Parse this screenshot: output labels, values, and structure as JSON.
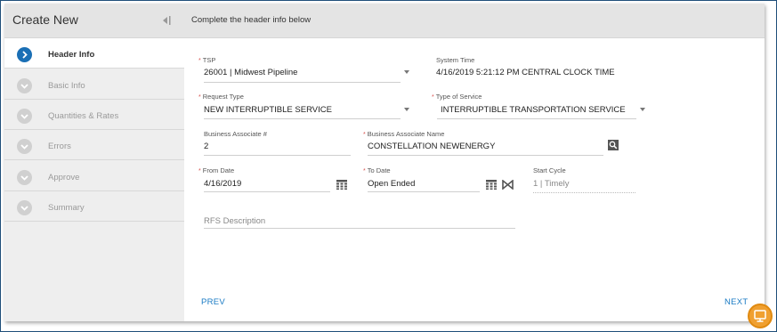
{
  "header": {
    "title": "Create New",
    "subtitle": "Complete the header info below",
    "collapse_icon": "collapse-left-icon"
  },
  "sidebar": {
    "steps": [
      {
        "label": "Header Info",
        "active": true
      },
      {
        "label": "Basic Info",
        "active": false
      },
      {
        "label": "Quantities & Rates",
        "active": false
      },
      {
        "label": "Errors",
        "active": false
      },
      {
        "label": "Approve",
        "active": false
      },
      {
        "label": "Summary",
        "active": false
      }
    ]
  },
  "form": {
    "tsp": {
      "label": "TSP",
      "required": "*",
      "value": "26001 | Midwest Pipeline"
    },
    "system_time": {
      "label": "System Time",
      "value": "4/16/2019 5:21:12 PM CENTRAL CLOCK TIME"
    },
    "request_type": {
      "label": "Request Type",
      "required": "*",
      "value": "NEW INTERRUPTIBLE SERVICE"
    },
    "type_of_service": {
      "label": "Type of Service",
      "required": "*",
      "value": "INTERRUPTIBLE TRANSPORTATION SERVICE"
    },
    "business_associate_num": {
      "label": "Business Associate #",
      "value": "2"
    },
    "business_associate_name": {
      "label": "Business Associate Name",
      "required": "*",
      "value": "CONSTELLATION NEWENERGY"
    },
    "from_date": {
      "label": "From Date",
      "required": "*",
      "value": "4/16/2019"
    },
    "to_date": {
      "label": "To Date",
      "required": "*",
      "value": "Open Ended"
    },
    "start_cycle": {
      "label": "Start Cycle",
      "value": "1 | Timely"
    },
    "rfs_description": {
      "placeholder": "RFS Description"
    }
  },
  "footer": {
    "prev": "PREV",
    "next": "NEXT"
  },
  "colors": {
    "accent": "#1a6fb5",
    "link": "#1a7bc4",
    "required": "#d9534f",
    "badge": "#f0a030"
  }
}
